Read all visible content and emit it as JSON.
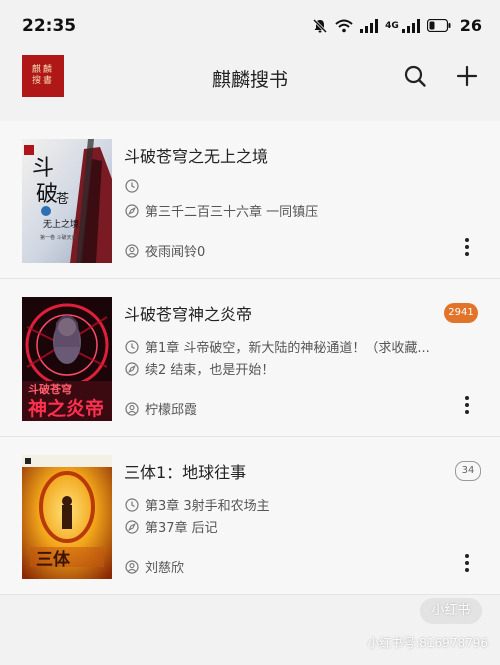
{
  "status_bar": {
    "time": "22:35",
    "network_label": "4G",
    "battery": "26"
  },
  "header": {
    "logo_text": "麒麟搜書",
    "title": "麒麟搜书",
    "search_icon": "search-icon",
    "add_icon": "plus-icon"
  },
  "books": [
    {
      "title": "斗破苍穹之无上之境",
      "latest_chapter": "",
      "last_read": "第三千二百三十六章 一同镇压",
      "author": "夜雨闻铃0",
      "badge": ""
    },
    {
      "title": "斗破苍穹神之炎帝",
      "latest_chapter": "第1章 斗帝破空，新大陆的神秘通道！（求收藏...",
      "last_read": "续2 结束，也是开始！",
      "author": "柠檬邱霞",
      "badge": "2941"
    },
    {
      "title": "三体1：地球往事",
      "latest_chapter": "第3章 3射手和农场主",
      "last_read": "第37章 后记",
      "author": "刘慈欣",
      "badge": "34"
    }
  ],
  "watermark": {
    "badge": "小红书",
    "id_text": "小红书号:816978796"
  },
  "colors": {
    "logo_bg": "#b01818",
    "badge_orange": "#e2742a",
    "background": "#f2f2f2"
  }
}
